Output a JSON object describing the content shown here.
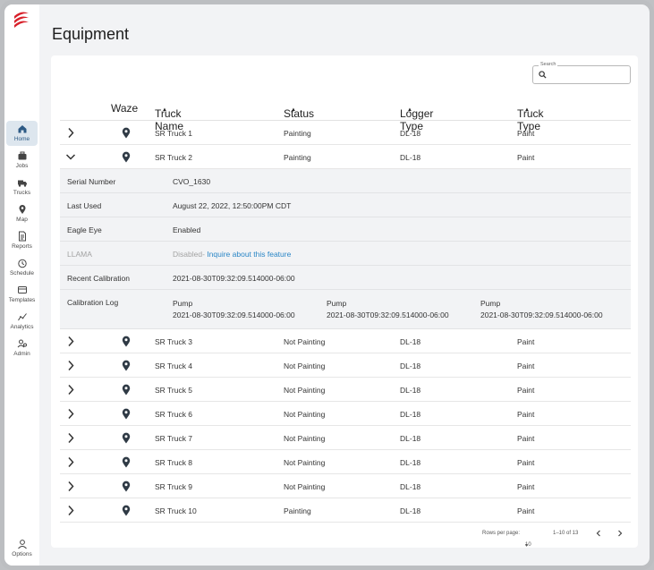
{
  "sidebar": {
    "items": [
      {
        "label": "Home",
        "icon": "home-icon"
      },
      {
        "label": "Jobs",
        "icon": "briefcase-icon"
      },
      {
        "label": "Trucks",
        "icon": "truck-icon"
      },
      {
        "label": "Map",
        "icon": "map-pin-icon"
      },
      {
        "label": "Reports",
        "icon": "report-icon"
      },
      {
        "label": "Schedule",
        "icon": "clock-icon"
      },
      {
        "label": "Templates",
        "icon": "template-icon"
      },
      {
        "label": "Analytics",
        "icon": "analytics-icon"
      },
      {
        "label": "Admin",
        "icon": "admin-icon"
      }
    ],
    "options_label": "Options"
  },
  "page": {
    "title": "Equipment"
  },
  "search": {
    "label": "Search",
    "value": ""
  },
  "table": {
    "headers": {
      "waze": "Waze",
      "truck_name": "Truck Name",
      "status": "Status",
      "logger_type": "Logger Type",
      "truck_type": "Truck Type"
    },
    "rows_before": [
      {
        "name": "SR Truck 1",
        "status": "Painting",
        "logger": "DL-18",
        "type": "Paint"
      },
      {
        "name": "SR Truck 2",
        "status": "Painting",
        "logger": "DL-18",
        "type": "Paint"
      }
    ],
    "details": {
      "serial_label": "Serial Number",
      "serial_value": "CVO_1630",
      "last_used_label": "Last Used",
      "last_used_value": "August 22, 2022, 12:50:00PM CDT",
      "eagle_label": "Eagle Eye",
      "eagle_value": "Enabled",
      "llama_label": "LLAMA",
      "llama_value": "Disabled-",
      "llama_link": "Inquire about this feature",
      "recent_label": "Recent Calibration",
      "recent_value": "2021-08-30T09:32:09.514000-06:00",
      "log_label": "Calibration Log",
      "log": [
        {
          "name": "Pump",
          "time": "2021-08-30T09:32:09.514000-06:00"
        },
        {
          "name": "Pump",
          "time": "2021-08-30T09:32:09.514000-06:00"
        },
        {
          "name": "Pump",
          "time": "2021-08-30T09:32:09.514000-06:00"
        }
      ]
    },
    "rows_after": [
      {
        "name": "SR Truck 3",
        "status": "Not Painting",
        "logger": "DL-18",
        "type": "Paint"
      },
      {
        "name": "SR Truck 4",
        "status": "Not Painting",
        "logger": "DL-18",
        "type": "Paint"
      },
      {
        "name": "SR Truck 5",
        "status": "Not Painting",
        "logger": "DL-18",
        "type": "Paint"
      },
      {
        "name": "SR Truck 6",
        "status": "Not Painting",
        "logger": "DL-18",
        "type": "Paint"
      },
      {
        "name": "SR Truck 7",
        "status": "Not Painting",
        "logger": "DL-18",
        "type": "Paint"
      },
      {
        "name": "SR Truck 8",
        "status": "Not Painting",
        "logger": "DL-18",
        "type": "Paint"
      },
      {
        "name": "SR Truck 9",
        "status": "Not Painting",
        "logger": "DL-18",
        "type": "Paint"
      },
      {
        "name": "SR Truck 10",
        "status": "Painting",
        "logger": "DL-18",
        "type": "Paint"
      }
    ]
  },
  "pagination": {
    "rows_label": "Rows per page:",
    "rows_value": "10",
    "range": "1–10 of 13"
  },
  "colors": {
    "accent": "#2d5a85",
    "link": "#2a86c6",
    "logo": "#d8202a"
  }
}
